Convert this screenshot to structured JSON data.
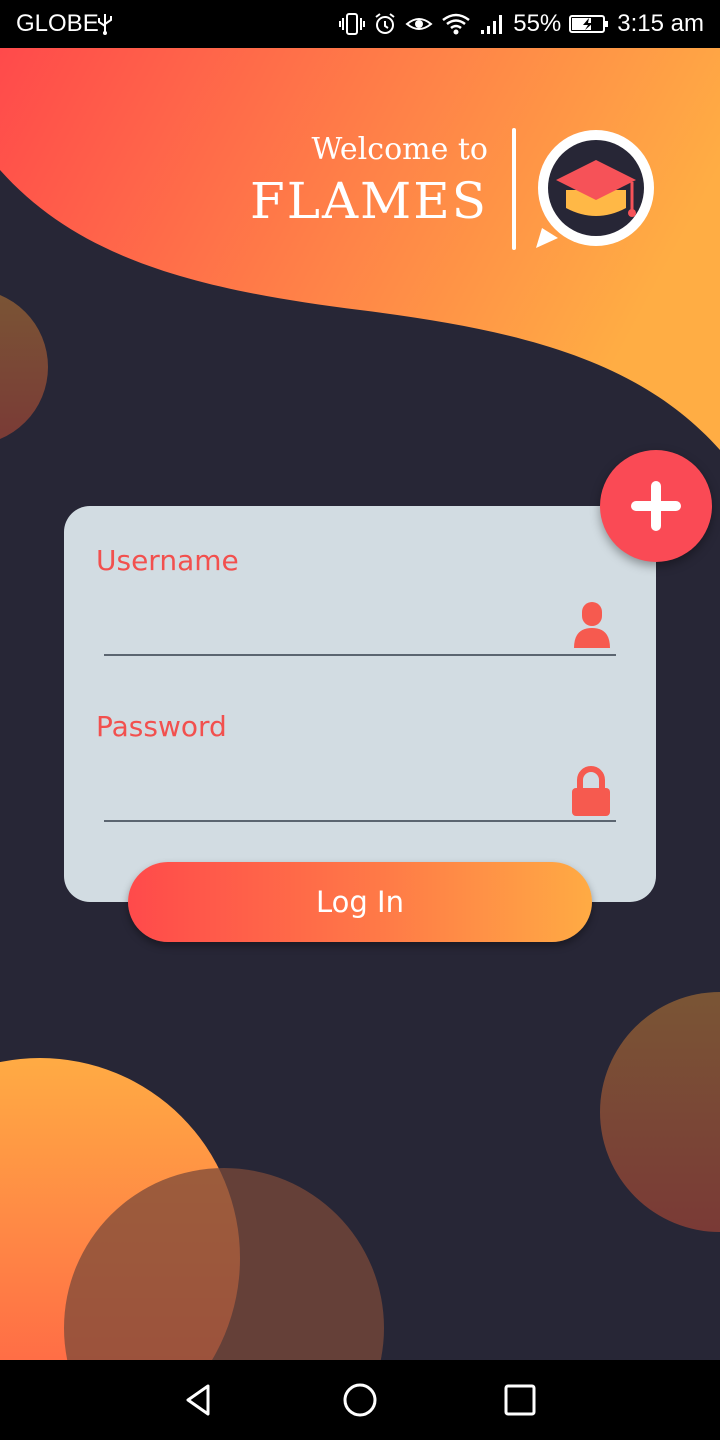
{
  "status_bar": {
    "carrier": "GLOBE",
    "battery": "55%",
    "time": "3:15 am",
    "icons": [
      "usb-icon",
      "vibrate-icon",
      "alarm-icon",
      "eye-icon",
      "wifi-icon",
      "signal-icon",
      "battery-charging-icon"
    ]
  },
  "header": {
    "welcome": "Welcome to",
    "brand": "FLAMES",
    "logo_icon": "graduation-cap-icon"
  },
  "login_form": {
    "username_label": "Username",
    "username_value": "",
    "username_icon": "user-icon",
    "password_label": "Password",
    "password_value": "",
    "password_icon": "lock-icon",
    "login_label": "Log In",
    "add_icon": "plus-icon"
  },
  "nav_bar": {
    "icons": [
      "back-icon",
      "home-icon",
      "recents-icon"
    ]
  },
  "colors": {
    "background": "#272636",
    "accent_red": "#fa4a55",
    "accent_orange": "#ffab44",
    "card": "#d2dce2",
    "label": "#f2504e"
  }
}
